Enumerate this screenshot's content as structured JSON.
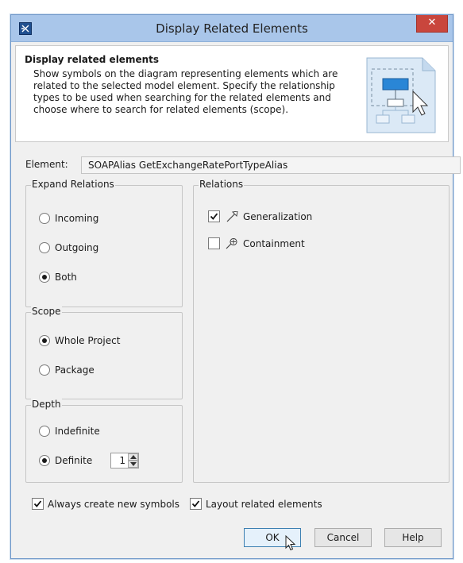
{
  "window": {
    "title": "Display Related Elements",
    "close_label": "✕"
  },
  "header": {
    "title": "Display related elements",
    "description": "Show symbols on the diagram representing elements which are related to the selected model element. Specify the relationship types to be used when searching for the related elements and choose where to search for related elements (scope)."
  },
  "element": {
    "label": "Element:",
    "value": "SOAPAlias GetExchangeRatePortTypeAlias"
  },
  "expand_relations": {
    "label": "Expand Relations",
    "options": [
      {
        "label": "Incoming",
        "selected": false
      },
      {
        "label": "Outgoing",
        "selected": false
      },
      {
        "label": "Both",
        "selected": true
      }
    ]
  },
  "scope": {
    "label": "Scope",
    "options": [
      {
        "label": "Whole Project",
        "selected": true
      },
      {
        "label": "Package",
        "selected": false
      }
    ]
  },
  "depth": {
    "label": "Depth",
    "options": [
      {
        "label": "Indefinite",
        "selected": false
      },
      {
        "label": "Definite",
        "selected": true
      }
    ],
    "value": "1"
  },
  "relations": {
    "label": "Relations",
    "items": [
      {
        "label": "Generalization",
        "checked": true,
        "icon": "generalization-icon"
      },
      {
        "label": "Containment",
        "checked": false,
        "icon": "containment-icon"
      }
    ]
  },
  "options": {
    "always_create_label": "Always create new symbols",
    "always_create_checked": true,
    "layout_label": "Layout related elements",
    "layout_checked": true
  },
  "buttons": {
    "ok": "OK",
    "cancel": "Cancel",
    "help": "Help"
  },
  "colors": {
    "titlebar": "#a9c6ea",
    "close": "#c9463d",
    "dialog_bg": "#f0f0f0"
  }
}
